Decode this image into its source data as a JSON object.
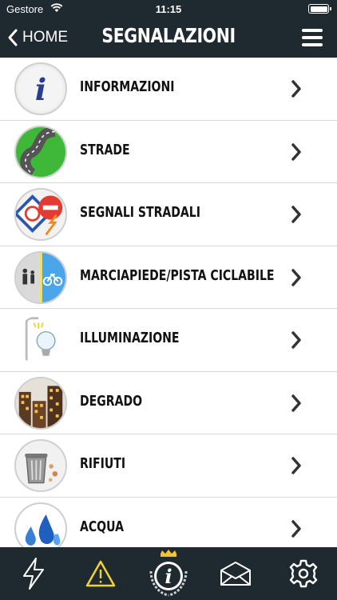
{
  "status": {
    "carrier": "Gestore",
    "time": "11:15"
  },
  "nav": {
    "back_label": "HOME",
    "title": "SEGNALAZIONI"
  },
  "items": [
    {
      "label": "INFORMAZIONI",
      "icon": "info-icon"
    },
    {
      "label": "STRADE",
      "icon": "road-icon"
    },
    {
      "label": "SEGNALI STRADALI",
      "icon": "road-signs-icon"
    },
    {
      "label": "MARCIAPIEDE/PISTA CICLABILE",
      "icon": "sidewalk-bike-lane-icon"
    },
    {
      "label": "ILLUMINAZIONE",
      "icon": "street-light-icon"
    },
    {
      "label": "DEGRADO",
      "icon": "decay-buildings-icon"
    },
    {
      "label": "RIFIUTI",
      "icon": "trash-bin-icon"
    },
    {
      "label": "ACQUA",
      "icon": "water-drops-icon"
    }
  ],
  "tabs": [
    {
      "icon": "lightning-icon"
    },
    {
      "icon": "warning-icon",
      "color": "#f2d22e"
    },
    {
      "icon": "municipal-info-crest-icon"
    },
    {
      "icon": "envelope-icon"
    },
    {
      "icon": "gear-icon"
    }
  ],
  "colors": {
    "bar_background": "#1e2a30",
    "warning_accent": "#f2d22e"
  }
}
